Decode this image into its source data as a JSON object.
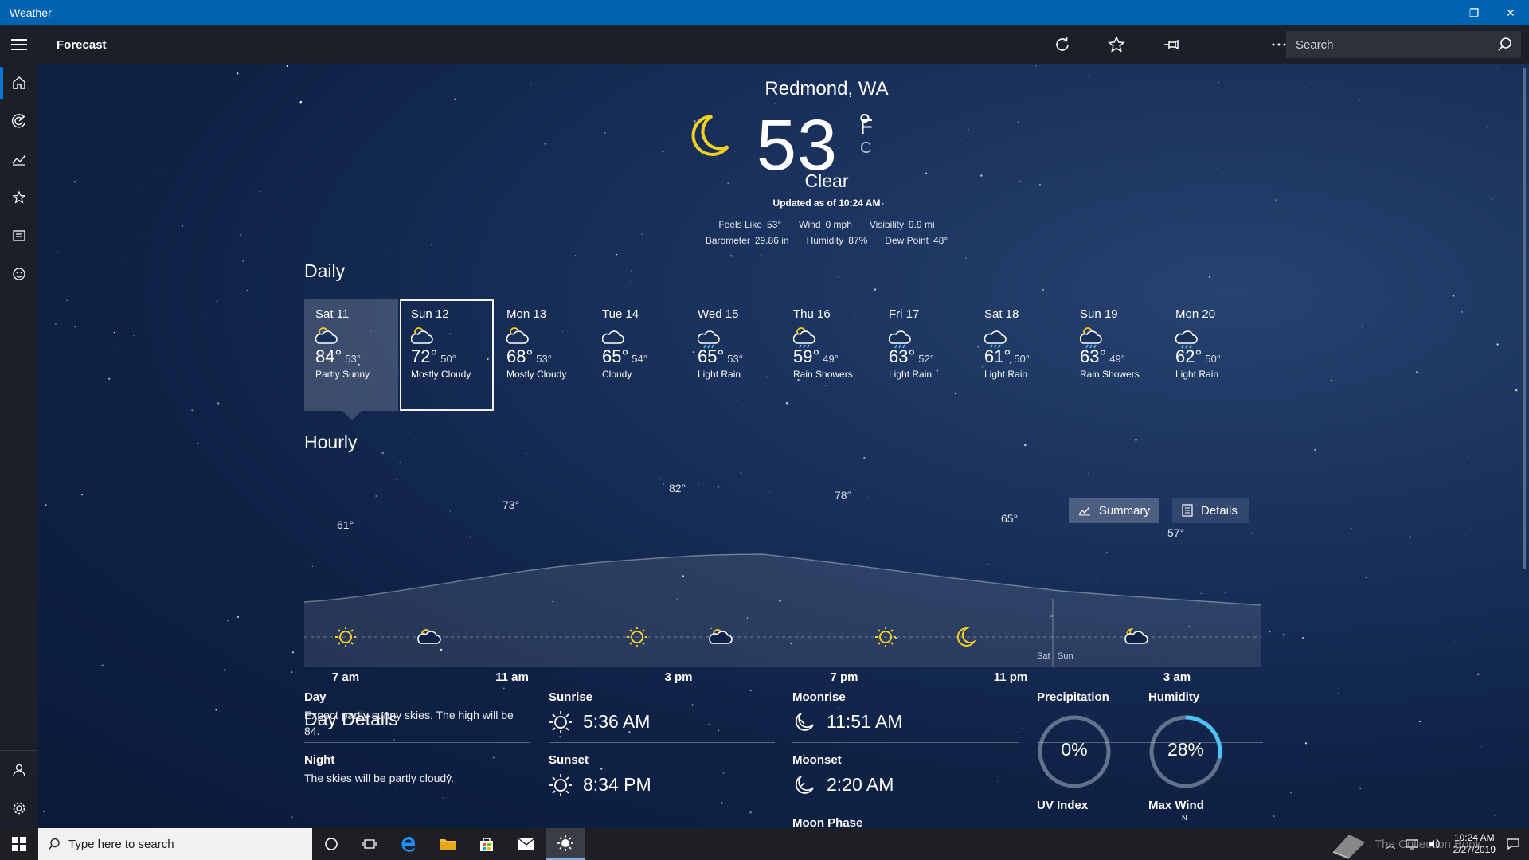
{
  "window": {
    "title": "Weather",
    "minimize": "—",
    "restore": "❐",
    "close": "✕"
  },
  "appbar": {
    "page_title": "Forecast",
    "search_placeholder": "Search"
  },
  "current": {
    "location": "Redmond, WA",
    "temperature": "53",
    "degree": "°",
    "unit_f": "F",
    "unit_c": "C",
    "condition": "Clear",
    "updated": "Updated as of 10:24 AM",
    "metrics_row1": [
      {
        "label": "Feels Like",
        "value": "53°"
      },
      {
        "label": "Wind",
        "value": "0 mph"
      },
      {
        "label": "Visibility",
        "value": "9.9 mi"
      }
    ],
    "metrics_row2": [
      {
        "label": "Barometer",
        "value": "29.86 in"
      },
      {
        "label": "Humidity",
        "value": "87%"
      },
      {
        "label": "Dew Point",
        "value": "48°"
      }
    ]
  },
  "daily": {
    "heading": "Daily",
    "days": [
      {
        "name": "Sat 11",
        "hi": "84°",
        "lo": "53°",
        "cond": "Partly Sunny",
        "icon": "partly-sunny-icon"
      },
      {
        "name": "Sun 12",
        "hi": "72°",
        "lo": "50°",
        "cond": "Mostly Cloudy",
        "icon": "mostly-cloudy-icon"
      },
      {
        "name": "Mon 13",
        "hi": "68°",
        "lo": "53°",
        "cond": "Mostly Cloudy",
        "icon": "mostly-cloudy-icon"
      },
      {
        "name": "Tue 14",
        "hi": "65°",
        "lo": "54°",
        "cond": "Cloudy",
        "icon": "cloudy-icon"
      },
      {
        "name": "Wed 15",
        "hi": "65°",
        "lo": "53°",
        "cond": "Light Rain",
        "icon": "light-rain-icon"
      },
      {
        "name": "Thu 16",
        "hi": "59°",
        "lo": "49°",
        "cond": "Rain Showers",
        "icon": "rain-showers-icon"
      },
      {
        "name": "Fri 17",
        "hi": "63°",
        "lo": "52°",
        "cond": "Light Rain",
        "icon": "light-rain-icon"
      },
      {
        "name": "Sat 18",
        "hi": "61°",
        "lo": "50°",
        "cond": "Light Rain",
        "icon": "light-rain-icon"
      },
      {
        "name": "Sun 19",
        "hi": "63°",
        "lo": "49°",
        "cond": "Rain Showers",
        "icon": "rain-showers-icon"
      },
      {
        "name": "Mon 20",
        "hi": "62°",
        "lo": "50°",
        "cond": "Light Rain",
        "icon": "light-rain-icon"
      }
    ]
  },
  "hourly": {
    "heading": "Hourly",
    "summary_label": "Summary",
    "details_label": "Details",
    "temp_labels": [
      "61°",
      "73°",
      "82°",
      "78°",
      "65°",
      "57°"
    ],
    "time_labels": [
      "7 am",
      "11 am",
      "3 pm",
      "7 pm",
      "11 pm",
      "3 am"
    ],
    "day_split": [
      "Sat",
      "Sun"
    ]
  },
  "day_details": {
    "heading": "Day Details",
    "day_label": "Day",
    "day_text": "Expect partly sunny skies. The high will be 84.",
    "night_label": "Night",
    "night_text": "The skies will be partly cloudy.",
    "sunrise_label": "Sunrise",
    "sunrise": "5:36 AM",
    "sunset_label": "Sunset",
    "sunset": "8:34 PM",
    "moonrise_label": "Moonrise",
    "moonrise": "11:51 AM",
    "moonset_label": "Moonset",
    "moonset": "2:20 AM",
    "moonphase_label": "Moon Phase",
    "precip_label": "Precipitation",
    "precip": "0%",
    "precip_fraction": 0.0,
    "humidity_label": "Humidity",
    "humidity": "28%",
    "humidity_fraction": 0.28,
    "uv_label": "UV Index",
    "wind_label": "Max Wind",
    "wind_dir": "N"
  },
  "taskbar": {
    "search_placeholder": "Type here to search",
    "time": "10:24 AM",
    "date": "2/27/2019",
    "watermark": "The Collection Book"
  },
  "colors": {
    "accent": "#0063b1",
    "sun": "#f5d020",
    "ring": "#4fc3f7"
  }
}
